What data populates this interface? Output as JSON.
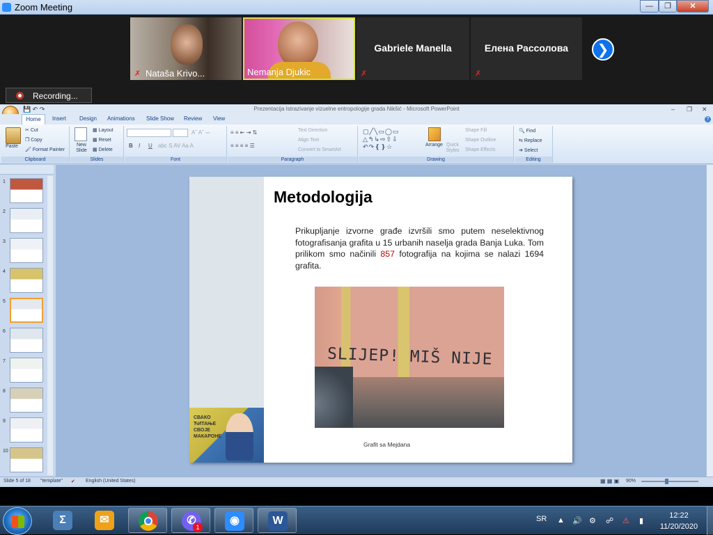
{
  "zoom": {
    "window_title": "Zoom Meeting",
    "participants": [
      {
        "name": "Nataša Krivo...",
        "muted": true
      },
      {
        "name": "Nemanja Djukic",
        "muted": false
      },
      {
        "name": "Gabriele Manella",
        "muted": true
      },
      {
        "name": "Елена Рассолова",
        "muted": true
      }
    ],
    "recording_label": "Recording..."
  },
  "powerpoint": {
    "window_title": "Prezentacija Istrazivanje vizuelne entropologije grada Nikšić - Microsoft PowerPoint",
    "tabs": [
      "Home",
      "Insert",
      "Design",
      "Animations",
      "Slide Show",
      "Review",
      "View"
    ],
    "ribbon": {
      "clipboard": {
        "label": "Clipboard",
        "paste": "Paste",
        "cut": "Cut",
        "copy": "Copy",
        "format_painter": "Format Painter"
      },
      "slides": {
        "label": "Slides",
        "new_slide": "New Slide",
        "layout": "Layout",
        "reset": "Reset",
        "delete": "Delete"
      },
      "font": {
        "label": "Font"
      },
      "paragraph": {
        "label": "Paragraph",
        "text_direction": "Text Direction",
        "align_text": "Align Text",
        "convert_smartart": "Convert to SmartArt"
      },
      "drawing": {
        "label": "Drawing",
        "arrange": "Arrange",
        "quick_styles": "Quick Styles",
        "shape_fill": "Shape Fill",
        "shape_outline": "Shape Outline",
        "shape_effects": "Shape Effects"
      },
      "editing": {
        "label": "Editing",
        "find": "Find",
        "replace": "Replace",
        "select": "Select"
      }
    },
    "slide_numbers": [
      "1",
      "2",
      "3",
      "4",
      "5",
      "6",
      "7",
      "8",
      "9",
      "10"
    ],
    "current_slide_index": 5,
    "slide": {
      "title": "Metodologija",
      "body_before": "Prikupljanje izvorne građe izvršili smo putem neselektivnog fotografisanja grafita u 15 urbanih naselja grada Banja Luka. Tom prilikom smo načinili ",
      "body_highlight": "857",
      "body_after": " fotografija na kojima se nalazi 1694 grafita.",
      "graffiti_text": "SLIJEP! MIŠ NIJE SLIJEP!",
      "caption": "Grafit sa Mejdana",
      "mural_text": "СВАКО ЋИТАЊЕ СВОЈЕ МАКАРОНЕ"
    },
    "status": {
      "slide_info": "Slide 5 of 18",
      "theme": "\"template\"",
      "language": "English (United States)",
      "zoom": "90%"
    }
  },
  "taskbar": {
    "language": "SR",
    "time": "12:22",
    "date": "11/20/2020",
    "viber_badge": "1"
  },
  "colors": {
    "zoom_blue": "#0e72ed",
    "highlight_red": "#c00000",
    "ribbon_label": "#15428b"
  }
}
